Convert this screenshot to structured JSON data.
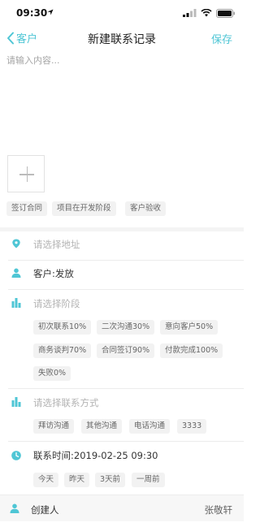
{
  "status": {
    "time": "09:30"
  },
  "nav": {
    "back_label": "客户",
    "title": "新建联系记录",
    "save_label": "保存"
  },
  "note": {
    "placeholder": "请输入内容..."
  },
  "attachment_tags": [
    "签订合同",
    "项目在开发阶段",
    "客户验收"
  ],
  "address": {
    "placeholder": "请选择地址"
  },
  "customer": {
    "text": "客户:发放"
  },
  "stage": {
    "placeholder": "请选择阶段",
    "options": [
      "初次联系10%",
      "二次沟通30%",
      "意向客户50%",
      "商务谈判70%",
      "合同签订90%",
      "付款完成100%",
      "失败0%"
    ]
  },
  "method": {
    "placeholder": "请选择联系方式",
    "options": [
      "拜访沟通",
      "其他沟通",
      "电话沟通",
      "3333"
    ]
  },
  "contact_time": {
    "text": "联系时间:2019-02-25 09:30",
    "quick_options": [
      "今天",
      "昨天",
      "3天前",
      "一周前"
    ]
  },
  "creator": {
    "label": "创建人",
    "value": "张敬轩"
  },
  "colors": {
    "accent": "#4fc6d5",
    "tag_bg": "#f2f2f2",
    "placeholder": "#b3b3b3"
  }
}
